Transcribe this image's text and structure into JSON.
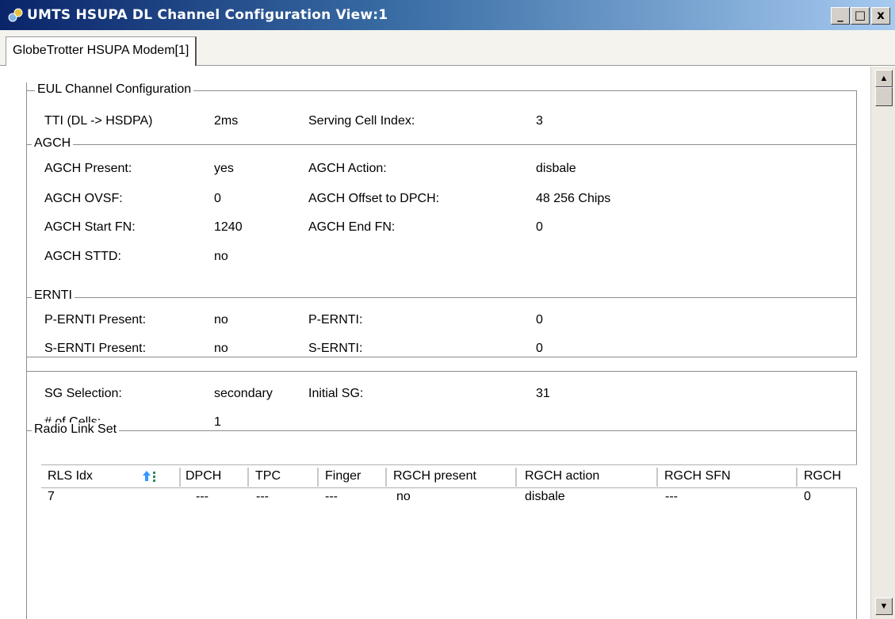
{
  "window": {
    "title": "UMTS HSUPA DL Channel Configuration View:1",
    "min": "_",
    "max": "□",
    "close": "x"
  },
  "tabs": [
    {
      "label": "GlobeTrotter HSUPA Modem[1]"
    }
  ],
  "eul": {
    "legend": "EUL Channel Configuration",
    "tti_label": "TTI (DL -> HSDPA)",
    "tti_value": "2ms",
    "serving_label": "Serving Cell Index:",
    "serving_value": "3"
  },
  "agch": {
    "legend": "AGCH",
    "present_label": "AGCH Present:",
    "present_value": "yes",
    "action_label": "AGCH Action:",
    "action_value": "disbale",
    "ovsf_label": "AGCH OVSF:",
    "ovsf_value": "0",
    "offset_label": "AGCH Offset to DPCH:",
    "offset_value": "48 256 Chips",
    "start_label": "AGCH Start FN:",
    "start_value": "1240",
    "end_label": "AGCH End FN:",
    "end_value": "0",
    "sttd_label": "AGCH STTD:",
    "sttd_value": "no"
  },
  "ernti": {
    "legend": "ERNTI",
    "p_present_label": "P-ERNTI Present:",
    "p_present_value": "no",
    "p_label": "P-ERNTI:",
    "p_value": "0",
    "s_present_label": "S-ERNTI Present:",
    "s_present_value": "no",
    "s_label": "S-ERNTI:",
    "s_value": "0"
  },
  "sg": {
    "selection_label": "SG Selection:",
    "selection_value": "secondary",
    "initial_label": "Initial SG:",
    "initial_value": "31",
    "cells_label": "# of Cells:",
    "cells_value": "1"
  },
  "rls": {
    "legend": "Radio Link Set",
    "columns": [
      "RLS Idx",
      "DPCH",
      "TPC",
      "Finger",
      "RGCH present",
      "RGCH action",
      "RGCH SFN",
      "RGCH"
    ],
    "rows": [
      [
        "7",
        "---",
        "---",
        "---",
        "no",
        "disbale",
        "---",
        "0"
      ]
    ]
  },
  "icons": {
    "app": "network-app-icon",
    "sort": "sort-ascending-icon",
    "up": "scroll-up-arrow-icon",
    "down": "scroll-down-arrow-icon"
  }
}
